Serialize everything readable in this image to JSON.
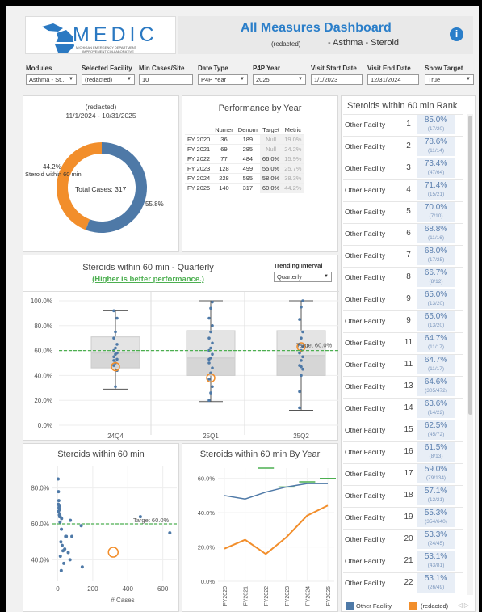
{
  "header": {
    "logo_text": "MEDIC",
    "logo_subtitle_1": "MICHIGAN EMERGENCY DEPARTMENT",
    "logo_subtitle_2": "IMPROVEMENT COLLABORATIVE",
    "title": "All Measures Dashboard",
    "redacted": "(redacted)",
    "subtitle": "- Asthma - Steroid",
    "info_icon": "info-icon"
  },
  "filters": {
    "modules": {
      "label": "Modules",
      "value": "Asthma - St..."
    },
    "facility": {
      "label": "Selected Facility",
      "value": "(redacted)"
    },
    "min_cases": {
      "label": "Min Cases/Site",
      "value": "10"
    },
    "date_type": {
      "label": "Date Type",
      "value": "P4P Year"
    },
    "p4p_year": {
      "label": "P4P Year",
      "value": "2025"
    },
    "visit_start": {
      "label": "Visit Start Date",
      "value": "1/1/2023"
    },
    "visit_end": {
      "label": "Visit End Date",
      "value": "12/31/2024"
    },
    "show_target": {
      "label": "Show Target",
      "value": "True"
    }
  },
  "donut": {
    "facility": "(redacted)",
    "date_range": "11/1/2024 - 10/31/2025",
    "orange_pct": "44.2%",
    "orange_label": "Steroid within 60 min",
    "total": "Total Cases: 317",
    "blue_pct": "55.8%",
    "orange_fraction": 0.442,
    "color_orange": "#f28e2b",
    "color_blue": "#4e79a7"
  },
  "perf": {
    "title": "Performance by Year",
    "headers": [
      "",
      "Numer",
      "Denom",
      "Target",
      "Metric"
    ],
    "rows": [
      [
        "FY 2020",
        "36",
        "189",
        "Null",
        "19.0%"
      ],
      [
        "FY 2021",
        "69",
        "285",
        "Null",
        "24.2%"
      ],
      [
        "FY 2022",
        "77",
        "484",
        "66.0%",
        "15.9%"
      ],
      [
        "FY 2023",
        "128",
        "499",
        "55.0%",
        "25.7%"
      ],
      [
        "FY 2024",
        "228",
        "595",
        "58.0%",
        "38.3%"
      ],
      [
        "FY 2025",
        "140",
        "317",
        "60.0%",
        "44.2%"
      ]
    ]
  },
  "rank": {
    "title": "Steroids within 60 min Rank",
    "rows": [
      {
        "name": "Other Facility",
        "rank": "1",
        "pct": "85.0%",
        "count": "(17/20)"
      },
      {
        "name": "Other Facility",
        "rank": "2",
        "pct": "78.6%",
        "count": "(11/14)"
      },
      {
        "name": "Other Facility",
        "rank": "3",
        "pct": "73.4%",
        "count": "(47/64)"
      },
      {
        "name": "Other Facility",
        "rank": "4",
        "pct": "71.4%",
        "count": "(15/21)"
      },
      {
        "name": "Other Facility",
        "rank": "5",
        "pct": "70.0%",
        "count": "(7/10)"
      },
      {
        "name": "Other Facility",
        "rank": "6",
        "pct": "68.8%",
        "count": "(11/16)"
      },
      {
        "name": "Other Facility",
        "rank": "7",
        "pct": "68.0%",
        "count": "(17/25)"
      },
      {
        "name": "Other Facility",
        "rank": "8",
        "pct": "66.7%",
        "count": "(8/12)"
      },
      {
        "name": "Other Facility",
        "rank": "9",
        "pct": "65.0%",
        "count": "(13/20)"
      },
      {
        "name": "Other Facility",
        "rank": "9",
        "pct": "65.0%",
        "count": "(13/20)"
      },
      {
        "name": "Other Facility",
        "rank": "11",
        "pct": "64.7%",
        "count": "(11/17)"
      },
      {
        "name": "Other Facility",
        "rank": "11",
        "pct": "64.7%",
        "count": "(11/17)"
      },
      {
        "name": "Other Facility",
        "rank": "13",
        "pct": "64.6%",
        "count": "(305/472)"
      },
      {
        "name": "Other Facility",
        "rank": "14",
        "pct": "63.6%",
        "count": "(14/22)"
      },
      {
        "name": "Other Facility",
        "rank": "15",
        "pct": "62.5%",
        "count": "(45/72)"
      },
      {
        "name": "Other Facility",
        "rank": "16",
        "pct": "61.5%",
        "count": "(8/13)"
      },
      {
        "name": "Other Facility",
        "rank": "17",
        "pct": "59.0%",
        "count": "(79/134)"
      },
      {
        "name": "Other Facility",
        "rank": "18",
        "pct": "57.1%",
        "count": "(12/21)"
      },
      {
        "name": "Other Facility",
        "rank": "19",
        "pct": "55.3%",
        "count": "(354/640)"
      },
      {
        "name": "Other Facility",
        "rank": "20",
        "pct": "53.3%",
        "count": "(24/45)"
      },
      {
        "name": "Other Facility",
        "rank": "21",
        "pct": "53.1%",
        "count": "(43/81)"
      },
      {
        "name": "Other Facility",
        "rank": "22",
        "pct": "53.1%",
        "count": "(26/49)"
      }
    ]
  },
  "legend": {
    "other": "Other Facility",
    "self": "(redacted)",
    "nav": "◁ ▷"
  },
  "quarterly": {
    "title": "Steroids within 60 min - Quarterly",
    "subtitle": "(Higher is better performance.)",
    "trend_label": "Trending Interval",
    "trend_value": "Quarterly",
    "target_label": "Target 60.0%"
  },
  "scatter": {
    "title": "Steroids within 60 min",
    "target_label": "Target 60.0%"
  },
  "byyear": {
    "title": "Steroids within 60 min By Year"
  },
  "chart_data": [
    {
      "type": "pie",
      "categories": [
        "Steroid within 60 min",
        "Other"
      ],
      "values": [
        44.2,
        55.8
      ],
      "total": "Total Cases: 317"
    },
    {
      "type": "box",
      "title": "Steroids within 60 min - Quarterly",
      "subtitle": "(Higher is better performance.)",
      "categories": [
        "24Q4",
        "25Q1",
        "25Q2"
      ],
      "ylim": [
        0,
        100
      ],
      "yticks": [
        "0.0%",
        "20.0%",
        "40.0%",
        "60.0%",
        "80.0%",
        "100.0%"
      ],
      "target": 60,
      "boxes": [
        {
          "min": 29,
          "q1": 46,
          "median": 58,
          "q3": 71,
          "max": 92
        },
        {
          "min": 19,
          "q1": 40,
          "median": 54,
          "q3": 76,
          "max": 100
        },
        {
          "min": 12,
          "q1": 40,
          "median": 56,
          "q3": 76,
          "max": 100
        }
      ],
      "selected": [
        47,
        38,
        63
      ],
      "points": [
        [
          48,
          50,
          53,
          55,
          57,
          58,
          60,
          62,
          65,
          70,
          75,
          86,
          92,
          31,
          44,
          52
        ],
        [
          37,
          42,
          46,
          50,
          54,
          57,
          60,
          62,
          66,
          70,
          75,
          80,
          86,
          94,
          99,
          20,
          26,
          31,
          53
        ],
        [
          14,
          40,
          45,
          48,
          52,
          55,
          58,
          60,
          63,
          65,
          70,
          75,
          85,
          95,
          100,
          27,
          47
        ]
      ]
    },
    {
      "type": "scatter",
      "title": "Steroids within 60 min",
      "xlabel": "# Cases",
      "xlim": [
        -30,
        680
      ],
      "ylim": [
        28,
        92
      ],
      "xticks": [
        0,
        200,
        400,
        600
      ],
      "yticks": [
        "40.0%",
        "60.0%",
        "80.0%"
      ],
      "target": 60,
      "points": [
        [
          2,
          85
        ],
        [
          4,
          78
        ],
        [
          6,
          73
        ],
        [
          3,
          71
        ],
        [
          8,
          70
        ],
        [
          7,
          69
        ],
        [
          10,
          68
        ],
        [
          5,
          67
        ],
        [
          12,
          65
        ],
        [
          9,
          65
        ],
        [
          14,
          64
        ],
        [
          11,
          64
        ],
        [
          472,
          64
        ],
        [
          22,
          63
        ],
        [
          72,
          62
        ],
        [
          13,
          61
        ],
        [
          134,
          59
        ],
        [
          21,
          57
        ],
        [
          640,
          55
        ],
        [
          45,
          53
        ],
        [
          81,
          53
        ],
        [
          49,
          53
        ],
        [
          18,
          50
        ],
        [
          25,
          48
        ],
        [
          40,
          46
        ],
        [
          30,
          45
        ],
        [
          60,
          44
        ],
        [
          15,
          42
        ],
        [
          70,
          40
        ],
        [
          35,
          38
        ],
        [
          140,
          36
        ],
        [
          20,
          34
        ]
      ],
      "selected": [
        317,
        44.2
      ]
    },
    {
      "type": "line",
      "title": "Steroids within 60 min By Year",
      "categories": [
        "FY2020",
        "FY2021",
        "FY2022",
        "FY2023",
        "FY2024",
        "FY2025"
      ],
      "ylim": [
        0,
        66
      ],
      "yticks": [
        "0.0%",
        "20.0%",
        "40.0%",
        "60.0%"
      ],
      "series": [
        {
          "name": "Other Facility",
          "values": [
            50,
            48,
            52,
            55,
            57,
            57
          ]
        },
        {
          "name": "(redacted)",
          "values": [
            19.0,
            24.2,
            15.9,
            25.7,
            38.3,
            44.2
          ]
        }
      ],
      "targets": [
        null,
        null,
        66,
        55,
        58,
        60
      ]
    }
  ]
}
